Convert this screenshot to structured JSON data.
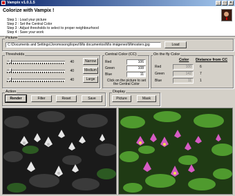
{
  "window": {
    "title": "Vampix v1.0.1.5"
  },
  "banner": {
    "heading": "Colorize with Vampix !",
    "steps": [
      "Step 1 : Load your picture",
      "Step 2 : Set the Central Color",
      "Step 3 : Adjust thresholds to select to proper neighbourhood",
      "Step 4 : Save your work"
    ]
  },
  "picture": {
    "group_label": "Picture",
    "path": "C:\\Documents and Settings\\Joromosong\\lopez\\Mis documentos\\Mis imágenes\\Mimosters.jpg",
    "load_label": "Load"
  },
  "thresholds": {
    "group_label": "Thresholds",
    "sliders": [
      {
        "value": "40"
      },
      {
        "value": "40"
      },
      {
        "value": "40"
      }
    ],
    "levels": [
      0.05,
      0.05,
      0.05
    ],
    "buttons": [
      "Narrow",
      "Medium",
      "Large"
    ]
  },
  "central_color": {
    "group_label": "Central Color (CC)",
    "labels": [
      "Red",
      "Green",
      "Blue"
    ],
    "values": [
      "106",
      "108",
      "11"
    ],
    "hint": "Click on the picture to set the Central Color"
  },
  "onfly": {
    "group_label": "On the fly Color",
    "labels": [
      "Red",
      "Green",
      "Blue"
    ],
    "values": [
      "100",
      "142",
      "11"
    ],
    "color_header": "Color",
    "distance_header": "Distance from CC",
    "distances": [
      "6",
      "7",
      "1"
    ]
  },
  "action": {
    "group_label": "Action",
    "buttons": [
      "Render",
      "Filter",
      "Reset",
      "Save"
    ]
  },
  "display": {
    "group_label": "Display",
    "buttons": [
      "Picture",
      "Mask"
    ]
  },
  "colors": {
    "accent": "#0a246a",
    "grass": "#3d8a2a",
    "flower_pink": "#d65bc3"
  }
}
